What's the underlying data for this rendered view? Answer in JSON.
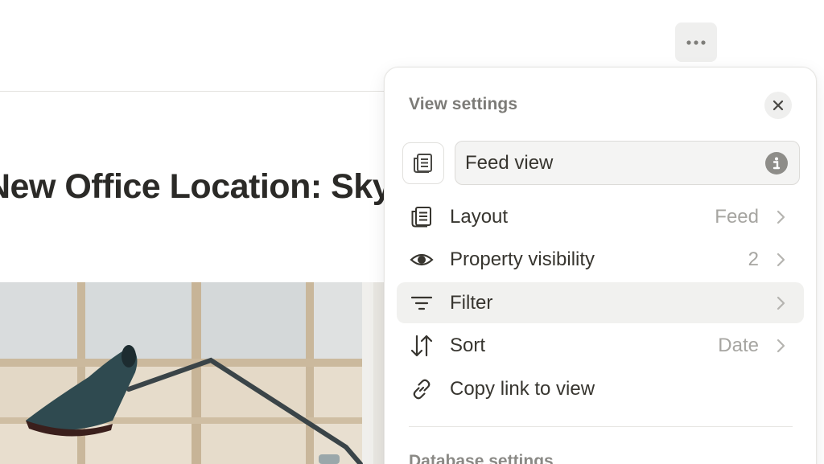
{
  "page": {
    "more_button": {
      "icon": "more-horizontal-icon"
    },
    "post_title": "New Office Location: SkyBridge Tower"
  },
  "view_settings": {
    "title": "View settings",
    "close_icon": "close-icon",
    "view_icon": "feed-view-icon",
    "name_value": "Feed view",
    "info_icon": "info-icon",
    "items": [
      {
        "label": "Layout",
        "value": "Feed",
        "icon": "feed-layout-icon"
      },
      {
        "label": "Property visibility",
        "value": "2",
        "icon": "eye-icon"
      },
      {
        "label": "Filter",
        "value": "",
        "icon": "filter-icon"
      },
      {
        "label": "Sort",
        "value": "Date",
        "icon": "sort-icon"
      },
      {
        "label": "Copy link to view",
        "value": "",
        "icon": "link-icon"
      }
    ],
    "section_label": "Database settings"
  },
  "colors": {
    "accent_hover": "#f1f1ef",
    "text": "#37352f",
    "muted": "#a6a5a1"
  }
}
